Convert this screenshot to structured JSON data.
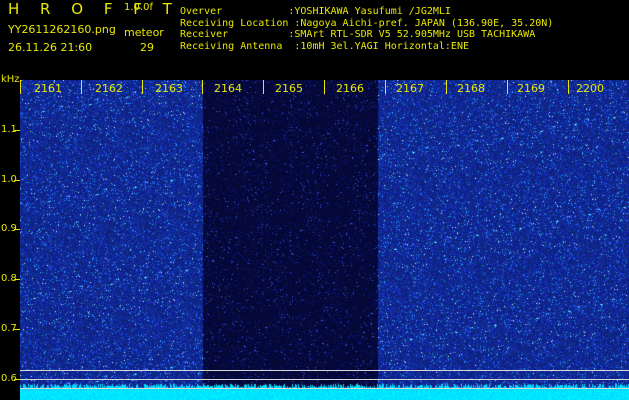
{
  "header": {
    "title": "H R O F F T",
    "version": "1.0.0f",
    "filename": "YY2611262160.png",
    "meteor_label": "meteor",
    "datetime": "26.11.26 21:60",
    "meteor_count": "29",
    "info_rows": [
      "Overver           :YOSHIKAWA Yasufumi /JG2MLI",
      "Receiving Location :Nagoya Aichi-pref. JAPAN (136.90E, 35.20N)",
      "Receiver          :SMArt RTL-SDR V5 52.905MHz USB TACHIKAWA",
      "Receiving Antenna  :10mH 3el.YAGI Horizontal:ENE"
    ]
  },
  "axis": {
    "unit": "kHz",
    "y_ticks": [
      "1.1",
      "1.0",
      "0.9",
      "0.8",
      "0.7",
      "0.6"
    ],
    "x_ticks": [
      "2161",
      "2162",
      "2163",
      "2164",
      "2165",
      "2166",
      "2167",
      "2168",
      "2169",
      "2200"
    ]
  },
  "colors": {
    "text": "#e8e800",
    "bright_band": "#1a2a9a",
    "dark_band": "#0a0f40",
    "noise_floor": "#00e0ff"
  }
}
